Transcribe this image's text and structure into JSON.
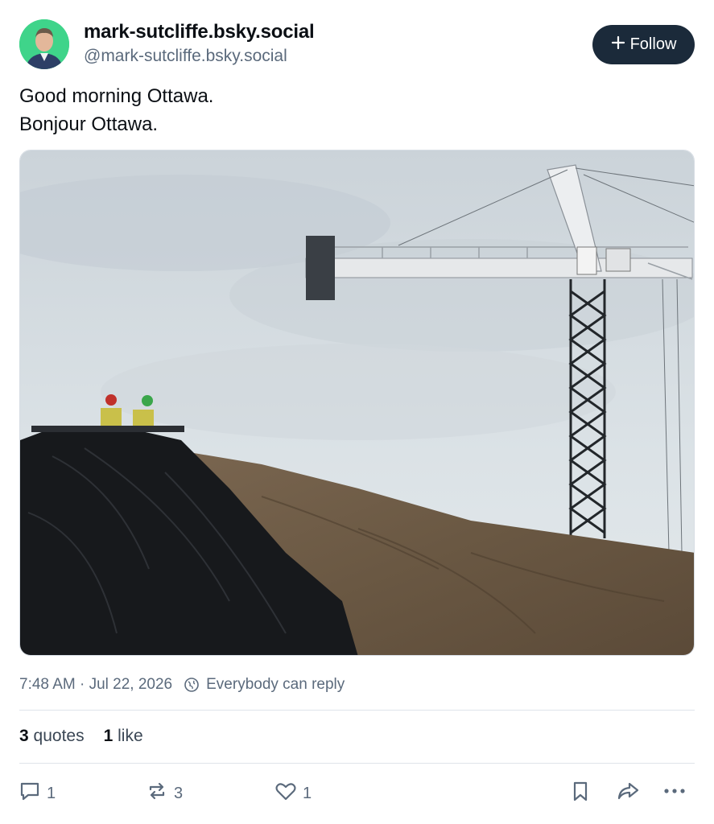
{
  "author": {
    "display_name": "mark-sutcliffe.bsky.social",
    "handle": "@mark-sutcliffe.bsky.social"
  },
  "follow_button": {
    "label": "Follow",
    "icon": "plus-icon"
  },
  "post": {
    "lines": [
      "Good morning Ottawa.",
      "Bonjour Ottawa."
    ]
  },
  "meta": {
    "timestamp": "7:48 AM · Jul 22, 2026",
    "reply_setting": "Everybody can reply"
  },
  "stats": {
    "quotes_count": "3",
    "quotes_label": "quotes",
    "likes_count": "1",
    "likes_label": "like"
  },
  "actions": {
    "replies": "1",
    "reposts": "3",
    "likes": "1"
  },
  "colors": {
    "follow_bg": "#1b2a3a",
    "muted_text": "#5b6a7c",
    "avatar_bg": "#3fd48a"
  }
}
